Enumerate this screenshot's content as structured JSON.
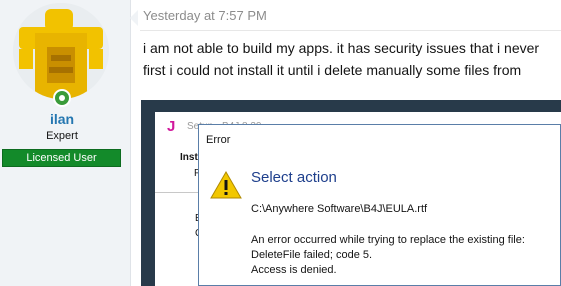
{
  "user": {
    "name": "ilan",
    "title": "Expert",
    "badge": "Licensed User"
  },
  "message": {
    "time": "Yesterday at 7:57 PM",
    "line1": "i am not able to build my apps. it has security issues that i never",
    "line2": "first i could not install it until i delete manually some files from"
  },
  "setup_window": {
    "icon_letter": "J",
    "title": "Setup - B4J 8.30",
    "heading": "Inst",
    "subtext": "P",
    "text1": "E",
    "text2": "C"
  },
  "error_dialog": {
    "title": "Error",
    "heading": "Select action",
    "path": "C:\\Anywhere Software\\B4J\\EULA.rtf",
    "line1": "An error occurred while trying to replace the existing file:",
    "line2": "DeleteFile failed; code 5.",
    "line3": "Access is denied."
  },
  "colors": {
    "username": "#2577b1",
    "badge_bg": "#138a2a",
    "dialog_heading": "#1e3f8c",
    "warning": "#f2c700"
  },
  "icons": {
    "status": "online-status-icon",
    "warning": "warning-icon"
  }
}
